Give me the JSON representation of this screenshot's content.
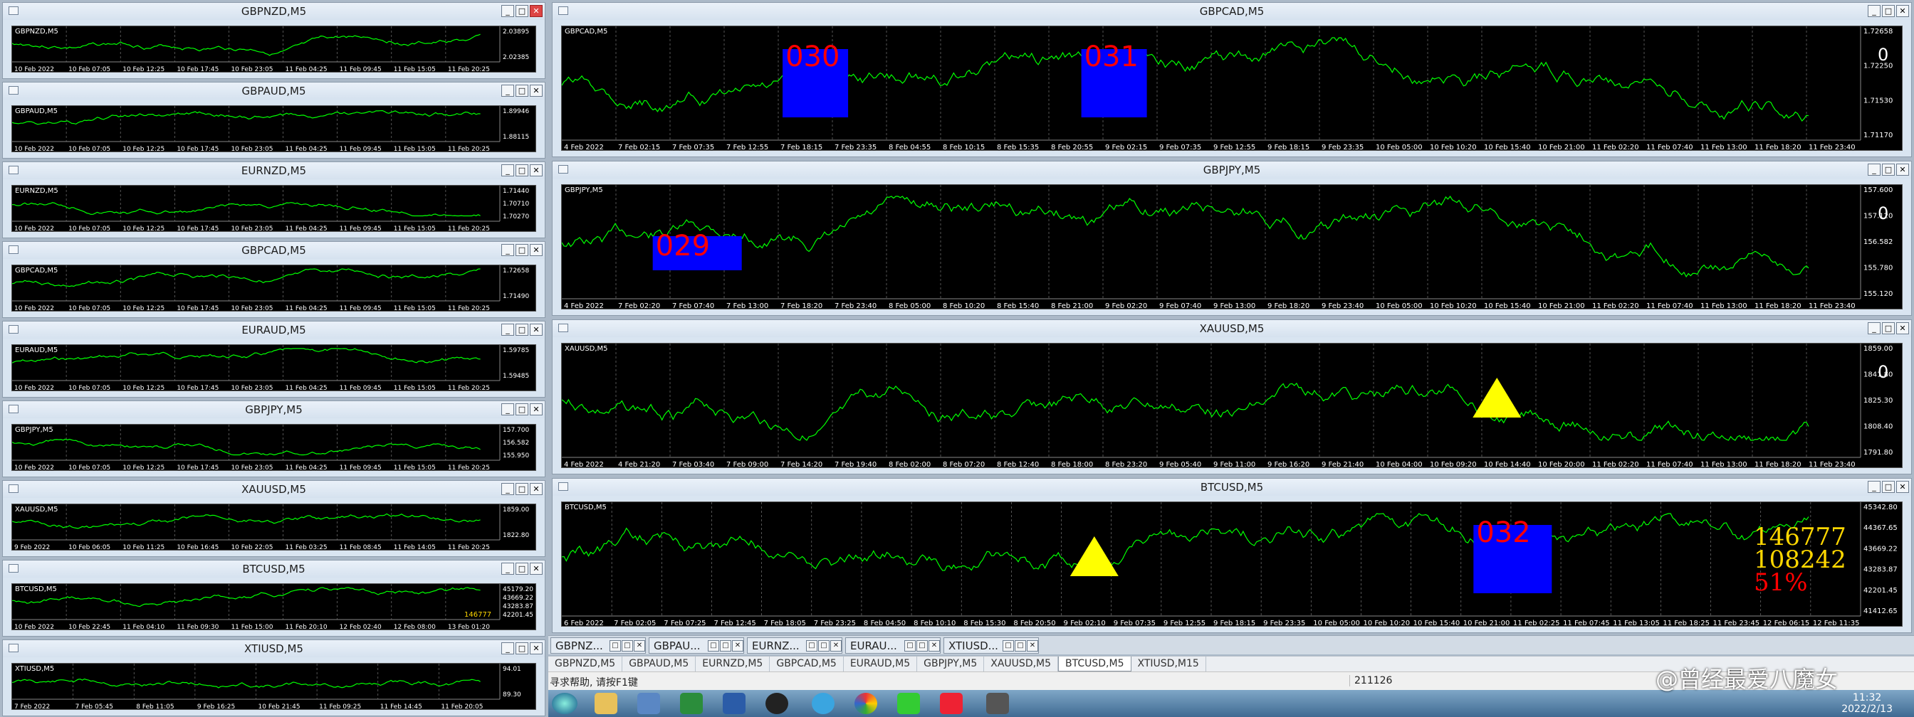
{
  "windows": [
    {
      "title": "GBPNZD,M5",
      "symbol": "GBPNZD,M5",
      "times": [
        "10 Feb 2022",
        "10 Feb 07:05",
        "10 Feb 12:25",
        "10 Feb 17:45",
        "10 Feb 23:05",
        "11 Feb 04:25",
        "11 Feb 09:45",
        "11 Feb 15:05",
        "11 Feb 20:25"
      ],
      "prices": [
        "2.03895",
        "2.02385"
      ]
    },
    {
      "title": "GBPAUD,M5",
      "symbol": "GBPAUD,M5",
      "times": [
        "10 Feb 2022",
        "10 Feb 07:05",
        "10 Feb 12:25",
        "10 Feb 17:45",
        "10 Feb 23:05",
        "11 Feb 04:25",
        "11 Feb 09:45",
        "11 Feb 15:05",
        "11 Feb 20:25"
      ],
      "prices": [
        "1.89946",
        "1.88115"
      ]
    },
    {
      "title": "EURNZD,M5",
      "symbol": "EURNZD,M5",
      "times": [
        "10 Feb 2022",
        "10 Feb 07:05",
        "10 Feb 12:25",
        "10 Feb 17:45",
        "10 Feb 23:05",
        "11 Feb 04:25",
        "11 Feb 09:45",
        "11 Feb 15:05",
        "11 Feb 20:25"
      ],
      "prices": [
        "1.71440",
        "1.70710",
        "1.70270"
      ]
    },
    {
      "title": "GBPCAD,M5",
      "symbol": "GBPCAD,M5",
      "times": [
        "10 Feb 2022",
        "10 Feb 07:05",
        "10 Feb 12:25",
        "10 Feb 17:45",
        "10 Feb 23:05",
        "11 Feb 04:25",
        "11 Feb 09:45",
        "11 Feb 15:05",
        "11 Feb 20:25"
      ],
      "prices": [
        "1.72658",
        "1.71490"
      ]
    },
    {
      "title": "EURAUD,M5",
      "symbol": "EURAUD,M5",
      "times": [
        "10 Feb 2022",
        "10 Feb 07:05",
        "10 Feb 12:25",
        "10 Feb 17:45",
        "10 Feb 23:05",
        "11 Feb 04:25",
        "11 Feb 09:45",
        "11 Feb 15:05",
        "11 Feb 20:25"
      ],
      "prices": [
        "1.59785",
        "1.59485"
      ]
    },
    {
      "title": "GBPJPY,M5",
      "symbol": "GBPJPY,M5",
      "times": [
        "10 Feb 2022",
        "10 Feb 07:05",
        "10 Feb 12:25",
        "10 Feb 17:45",
        "10 Feb 23:05",
        "11 Feb 04:25",
        "11 Feb 09:45",
        "11 Feb 15:05",
        "11 Feb 20:25"
      ],
      "prices": [
        "157.700",
        "156.582",
        "155.950"
      ]
    },
    {
      "title": "XAUUSD,M5",
      "symbol": "XAUUSD,M5",
      "times": [
        "9 Feb 2022",
        "10 Feb 06:05",
        "10 Feb 11:25",
        "10 Feb 16:45",
        "10 Feb 22:05",
        "11 Feb 03:25",
        "11 Feb 08:45",
        "11 Feb 14:05",
        "11 Feb 20:25"
      ],
      "prices": [
        "1859.00",
        "1822.80"
      ]
    },
    {
      "title": "BTCUSD,M5",
      "symbol": "BTCUSD,M5",
      "times": [
        "10 Feb 2022",
        "10 Feb 22:45",
        "11 Feb 04:10",
        "11 Feb 09:30",
        "11 Feb 15:00",
        "11 Feb 20:10",
        "12 Feb 02:40",
        "12 Feb 08:00",
        "13 Feb 01:20"
      ],
      "prices": [
        "45179.20",
        "43669.22",
        "43283.87",
        "42201.45"
      ],
      "label": "146777"
    },
    {
      "title": "XTIUSD,M5",
      "symbol": "XTIUSD,M5",
      "times": [
        "7 Feb 2022",
        "7 Feb 05:45",
        "8 Feb 11:05",
        "9 Feb 16:25",
        "10 Feb 21:45",
        "11 Feb 09:25",
        "11 Feb 14:45",
        "11 Feb 20:05"
      ],
      "prices": [
        "94.01",
        "89.30"
      ]
    },
    {
      "title": "GBPCAD,M5",
      "symbol": "GBPCAD,M5",
      "times": [
        "4 Feb 2022",
        "7 Feb 02:15",
        "7 Feb 07:35",
        "7 Feb 12:55",
        "7 Feb 18:15",
        "7 Feb 23:35",
        "8 Feb 04:55",
        "8 Feb 10:15",
        "8 Feb 15:35",
        "8 Feb 20:55",
        "9 Feb 02:15",
        "9 Feb 07:35",
        "9 Feb 12:55",
        "9 Feb 18:15",
        "9 Feb 23:35",
        "10 Feb 05:00",
        "10 Feb 10:20",
        "10 Feb 15:40",
        "10 Feb 21:00",
        "11 Feb 02:20",
        "11 Feb 07:40",
        "11 Feb 13:00",
        "11 Feb 18:20",
        "11 Feb 23:40"
      ],
      "prices": [
        "1.72658",
        "1.72250",
        "1.71530",
        "1.71170"
      ],
      "big": "0",
      "boxes": [
        "030",
        "031"
      ]
    },
    {
      "title": "GBPJPY,M5",
      "symbol": "GBPJPY,M5",
      "times": [
        "4 Feb 2022",
        "7 Feb 02:20",
        "7 Feb 07:40",
        "7 Feb 13:00",
        "7 Feb 18:20",
        "7 Feb 23:40",
        "8 Feb 05:00",
        "8 Feb 10:20",
        "8 Feb 15:40",
        "8 Feb 21:00",
        "9 Feb 02:20",
        "9 Feb 07:40",
        "9 Feb 13:00",
        "9 Feb 18:20",
        "9 Feb 23:40",
        "10 Feb 05:00",
        "10 Feb 10:20",
        "10 Feb 15:40",
        "10 Feb 21:00",
        "11 Feb 02:20",
        "11 Feb 07:40",
        "11 Feb 13:00",
        "11 Feb 18:20",
        "11 Feb 23:40"
      ],
      "prices": [
        "157.600",
        "157.120",
        "156.582",
        "155.780",
        "155.120"
      ],
      "big": "0",
      "boxes": [
        "029"
      ]
    },
    {
      "title": "XAUUSD,M5",
      "symbol": "XAUUSD,M5",
      "times": [
        "4 Feb 2022",
        "4 Feb 21:20",
        "7 Feb 03:40",
        "7 Feb 09:00",
        "7 Feb 14:20",
        "7 Feb 19:40",
        "8 Feb 02:00",
        "8 Feb 07:20",
        "8 Feb 12:40",
        "8 Feb 18:00",
        "8 Feb 23:20",
        "9 Feb 05:40",
        "9 Feb 11:00",
        "9 Feb 16:20",
        "9 Feb 21:40",
        "10 Feb 04:00",
        "10 Feb 09:20",
        "10 Feb 14:40",
        "10 Feb 20:00",
        "11 Feb 02:20",
        "11 Feb 07:40",
        "11 Feb 13:00",
        "11 Feb 18:20",
        "11 Feb 23:40"
      ],
      "prices": [
        "1859.00",
        "1841.80",
        "1825.30",
        "1808.40",
        "1791.80"
      ],
      "big": "0"
    },
    {
      "title": "BTCUSD,M5",
      "symbol": "BTCUSD,M5",
      "times": [
        "6 Feb 2022",
        "7 Feb 02:05",
        "7 Feb 07:25",
        "7 Feb 12:45",
        "7 Feb 18:05",
        "7 Feb 23:25",
        "8 Feb 04:50",
        "8 Feb 10:10",
        "8 Feb 15:30",
        "8 Feb 20:50",
        "9 Feb 02:10",
        "9 Feb 07:35",
        "9 Feb 12:55",
        "9 Feb 18:15",
        "9 Feb 23:35",
        "10 Feb 05:00",
        "10 Feb 10:20",
        "10 Feb 15:40",
        "10 Feb 21:00",
        "11 Feb 02:25",
        "11 Feb 07:45",
        "11 Feb 13:05",
        "11 Feb 18:25",
        "11 Feb 23:45",
        "12 Feb 06:15",
        "12 Feb 11:35"
      ],
      "prices": [
        "45342.80",
        "44367.65",
        "43669.22",
        "43283.87",
        "42201.45",
        "41412.65"
      ],
      "stats": [
        "146777",
        "108242",
        "51%"
      ],
      "boxes": [
        "032"
      ]
    }
  ],
  "window_tabs": [
    "GBPNZ...",
    "GBPAU...",
    "EURNZ...",
    "EURAU...",
    "XTIUSD..."
  ],
  "sheet_tabs": [
    "GBPNZD,M5",
    "GBPAUD,M5",
    "EURNZD,M5",
    "GBPCAD,M5",
    "EURAUD,M5",
    "GBPJPY,M5",
    "XAUUSD,M5",
    "BTCUSD,M5",
    "XTIUSD,M15"
  ],
  "status": {
    "help": "寻求帮助, 请按F1键",
    "kb": "211126"
  },
  "watermark": "@曾经最爱八魔女",
  "clock": {
    "time": "11:32",
    "date": "2022/2/13"
  },
  "colors": {
    "price": "#00ff00",
    "box": "#0000ff",
    "label": "#ff0000",
    "stat": "#ffd700",
    "triangle": "#ffff00"
  }
}
